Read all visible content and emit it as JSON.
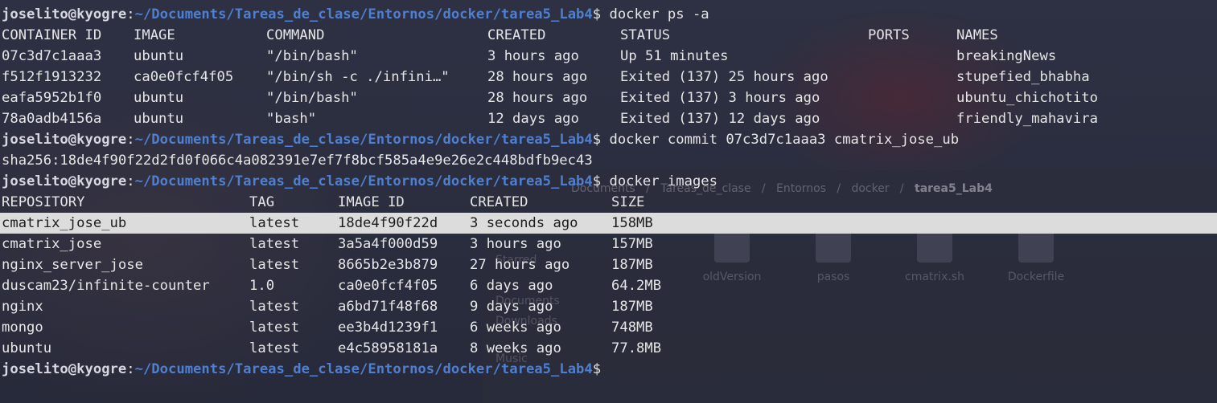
{
  "prompt": {
    "user": "joselito",
    "at": "@",
    "host": "kyogre",
    "colon": ":",
    "path": "~/Documents/Tareas_de_clase/Entornos/docker/tarea5_Lab4",
    "dollar": "$"
  },
  "commands": {
    "ps": "docker ps -a",
    "commit": "docker commit 07c3d7c1aaa3 cmatrix_jose_ub",
    "images": "docker images"
  },
  "ps_table": {
    "headers": [
      "CONTAINER ID",
      "IMAGE",
      "COMMAND",
      "CREATED",
      "STATUS",
      "PORTS",
      "NAMES"
    ],
    "rows": [
      [
        "07c3d7c1aaa3",
        "ubuntu",
        "\"/bin/bash\"",
        "3 hours ago",
        "Up 51 minutes",
        "",
        "breakingNews"
      ],
      [
        "f512f1913232",
        "ca0e0fcf4f05",
        "\"/bin/sh -c ./infini…\"",
        "28 hours ago",
        "Exited (137) 25 hours ago",
        "",
        "stupefied_bhabha"
      ],
      [
        "eafa5952b1f0",
        "ubuntu",
        "\"/bin/bash\"",
        "28 hours ago",
        "Exited (137) 3 hours ago",
        "",
        "ubuntu_chichotito"
      ],
      [
        "78a0adb4156a",
        "ubuntu",
        "\"bash\"",
        "12 days ago",
        "Exited (137) 12 days ago",
        "",
        "friendly_mahavira"
      ]
    ]
  },
  "commit_output": "sha256:18de4f90f22d2fd0f066c4a082391e7ef7f8bcf585a4e9e26e2c448bdfb9ec43",
  "images_table": {
    "headers": [
      "REPOSITORY",
      "TAG",
      "IMAGE ID",
      "CREATED",
      "SIZE"
    ],
    "rows": [
      [
        "cmatrix_jose_ub",
        "latest",
        "18de4f90f22d",
        "3 seconds ago",
        "158MB"
      ],
      [
        "cmatrix_jose",
        "latest",
        "3a5a4f000d59",
        "3 hours ago",
        "157MB"
      ],
      [
        "nginx_server_jose",
        "latest",
        "8665b2e3b879",
        "27 hours ago",
        "187MB"
      ],
      [
        "duscam23/infinite-counter",
        "1.0",
        "ca0e0fcf4f05",
        "6 days ago",
        "64.2MB"
      ],
      [
        "nginx",
        "latest",
        "a6bd71f48f68",
        "9 days ago",
        "187MB"
      ],
      [
        "mongo",
        "latest",
        "ee3b4d1239f1",
        "6 weeks ago",
        "748MB"
      ],
      [
        "ubuntu",
        "latest",
        "e4c58958181a",
        "8 weeks ago",
        "77.8MB"
      ]
    ]
  },
  "background_window": {
    "path": [
      "Documents",
      "Tareas_de_clase",
      "Entornos",
      "docker",
      "tarea5_Lab4"
    ],
    "sidebar": [
      "Starred",
      "Documents",
      "Downloads",
      "Music"
    ],
    "files": [
      "oldVersion",
      "pasos",
      "cmatrix.sh",
      "Dockerfile"
    ]
  },
  "colors": {
    "path": "#4e7fd0",
    "selection": "#dcdcdc",
    "text": "#e6e6e6",
    "background": "#2b2f3f"
  }
}
